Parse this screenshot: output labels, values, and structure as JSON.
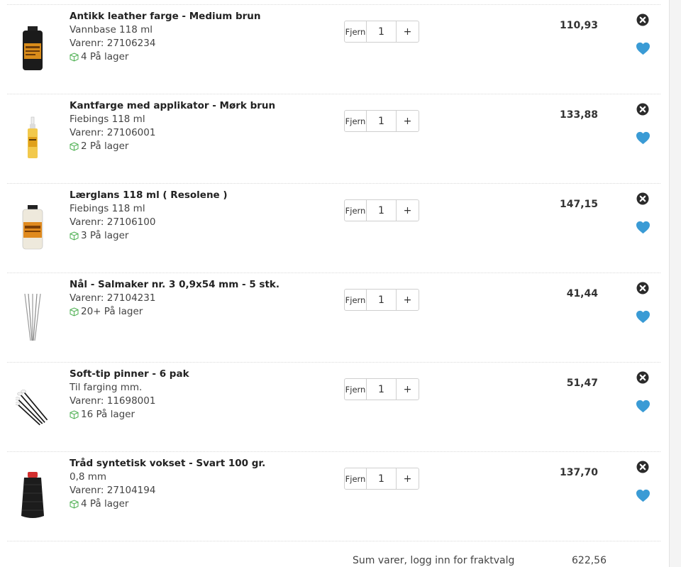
{
  "cart": {
    "items": [
      {
        "title": "Antikk leather farge - Medium brun",
        "subtitle": "Vannbase 118 ml",
        "sku": "Varenr: 27106234",
        "stock": "4 På lager",
        "remove_label": "Fjern",
        "quantity": "1",
        "plus_label": "+",
        "price": "110,93",
        "image": "leather-dye-bottle"
      },
      {
        "title": "Kantfarge med applikator - Mørk brun",
        "subtitle": "Fiebings 118 ml",
        "sku": "Varenr: 27106001",
        "stock": "2 På lager",
        "remove_label": "Fjern",
        "quantity": "1",
        "plus_label": "+",
        "price": "133,88",
        "image": "edge-dye-applicator"
      },
      {
        "title": "Lærglans 118 ml ( Resolene )",
        "subtitle": "Fiebings 118 ml",
        "sku": "Varenr: 27106100",
        "stock": "3 På lager",
        "remove_label": "Fjern",
        "quantity": "1",
        "plus_label": "+",
        "price": "147,15",
        "image": "resolene-bottle"
      },
      {
        "title": "Nål - Salmaker nr. 3 0,9x54 mm - 5 stk.",
        "sku": "Varenr: 27104231",
        "stock": "20+ På lager",
        "remove_label": "Fjern",
        "quantity": "1",
        "plus_label": "+",
        "price": "41,44",
        "image": "saddler-needles"
      },
      {
        "title": "Soft-tip pinner - 6 pak",
        "subtitle": "Til farging mm.",
        "sku": "Varenr: 11698001",
        "stock": "16 På lager",
        "remove_label": "Fjern",
        "quantity": "1",
        "plus_label": "+",
        "price": "51,47",
        "image": "soft-tip-sticks"
      },
      {
        "title": "Tråd syntetisk vokset - Svart 100 gr.",
        "subtitle": "0,8 mm",
        "sku": "Varenr: 27104194",
        "stock": "4 På lager",
        "remove_label": "Fjern",
        "quantity": "1",
        "plus_label": "+",
        "price": "137,70",
        "image": "waxed-thread-spool"
      }
    ],
    "summary": {
      "label": "Sum varer, logg inn for fraktvalg",
      "total": "622,56"
    }
  },
  "colors": {
    "favorite": "#3a9bd5",
    "delete": "#2b2b2b",
    "stock_icon": "#4caf50",
    "divider": "#d9d9d9"
  },
  "icons": {
    "delete": "close-circle-icon",
    "favorite": "heart-icon",
    "stock": "box-icon"
  }
}
